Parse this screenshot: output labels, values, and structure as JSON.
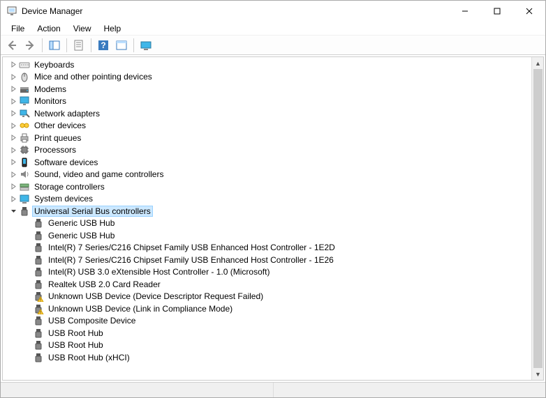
{
  "window": {
    "title": "Device Manager"
  },
  "menubar": {
    "items": [
      "File",
      "Action",
      "View",
      "Help"
    ]
  },
  "toolbar": {
    "buttons": [
      {
        "name": "back-icon"
      },
      {
        "name": "forward-icon"
      },
      {
        "sep": true
      },
      {
        "name": "show-hide-console-tree-icon"
      },
      {
        "sep": true
      },
      {
        "name": "properties-icon"
      },
      {
        "sep": true
      },
      {
        "name": "help-icon"
      },
      {
        "name": "action-menu-icon"
      },
      {
        "sep": true
      },
      {
        "name": "show-hidden-devices-icon"
      }
    ]
  },
  "tree": [
    {
      "level": 1,
      "icon": "keyboard-icon",
      "label": "Keyboards",
      "expandable": true,
      "expanded": false
    },
    {
      "level": 1,
      "icon": "mouse-icon",
      "label": "Mice and other pointing devices",
      "expandable": true,
      "expanded": false
    },
    {
      "level": 1,
      "icon": "modem-icon",
      "label": "Modems",
      "expandable": true,
      "expanded": false
    },
    {
      "level": 1,
      "icon": "monitor-icon",
      "label": "Monitors",
      "expandable": true,
      "expanded": false
    },
    {
      "level": 1,
      "icon": "network-icon",
      "label": "Network adapters",
      "expandable": true,
      "expanded": false
    },
    {
      "level": 1,
      "icon": "other-devices-icon",
      "label": "Other devices",
      "expandable": true,
      "expanded": false
    },
    {
      "level": 1,
      "icon": "printer-icon",
      "label": "Print queues",
      "expandable": true,
      "expanded": false
    },
    {
      "level": 1,
      "icon": "processor-icon",
      "label": "Processors",
      "expandable": true,
      "expanded": false
    },
    {
      "level": 1,
      "icon": "software-device-icon",
      "label": "Software devices",
      "expandable": true,
      "expanded": false
    },
    {
      "level": 1,
      "icon": "sound-icon",
      "label": "Sound, video and game controllers",
      "expandable": true,
      "expanded": false
    },
    {
      "level": 1,
      "icon": "storage-controller-icon",
      "label": "Storage controllers",
      "expandable": true,
      "expanded": false
    },
    {
      "level": 1,
      "icon": "system-device-icon",
      "label": "System devices",
      "expandable": true,
      "expanded": false
    },
    {
      "level": 1,
      "icon": "usb-controller-icon",
      "label": "Universal Serial Bus controllers",
      "expandable": true,
      "expanded": true,
      "selected": true
    },
    {
      "level": 2,
      "icon": "usb-device-icon",
      "label": "Generic USB Hub"
    },
    {
      "level": 2,
      "icon": "usb-device-icon",
      "label": "Generic USB Hub"
    },
    {
      "level": 2,
      "icon": "usb-device-icon",
      "label": "Intel(R) 7 Series/C216 Chipset Family USB Enhanced Host Controller - 1E2D"
    },
    {
      "level": 2,
      "icon": "usb-device-icon",
      "label": "Intel(R) 7 Series/C216 Chipset Family USB Enhanced Host Controller - 1E26"
    },
    {
      "level": 2,
      "icon": "usb-device-icon",
      "label": "Intel(R) USB 3.0 eXtensible Host Controller - 1.0 (Microsoft)"
    },
    {
      "level": 2,
      "icon": "usb-device-icon",
      "label": "Realtek USB 2.0 Card Reader"
    },
    {
      "level": 2,
      "icon": "usb-device-warning-icon",
      "label": "Unknown USB Device (Device Descriptor Request Failed)"
    },
    {
      "level": 2,
      "icon": "usb-device-warning-icon",
      "label": "Unknown USB Device (Link in Compliance Mode)"
    },
    {
      "level": 2,
      "icon": "usb-device-icon",
      "label": "USB Composite Device"
    },
    {
      "level": 2,
      "icon": "usb-device-icon",
      "label": "USB Root Hub"
    },
    {
      "level": 2,
      "icon": "usb-device-icon",
      "label": "USB Root Hub"
    },
    {
      "level": 2,
      "icon": "usb-device-icon",
      "label": "USB Root Hub (xHCI)"
    }
  ]
}
